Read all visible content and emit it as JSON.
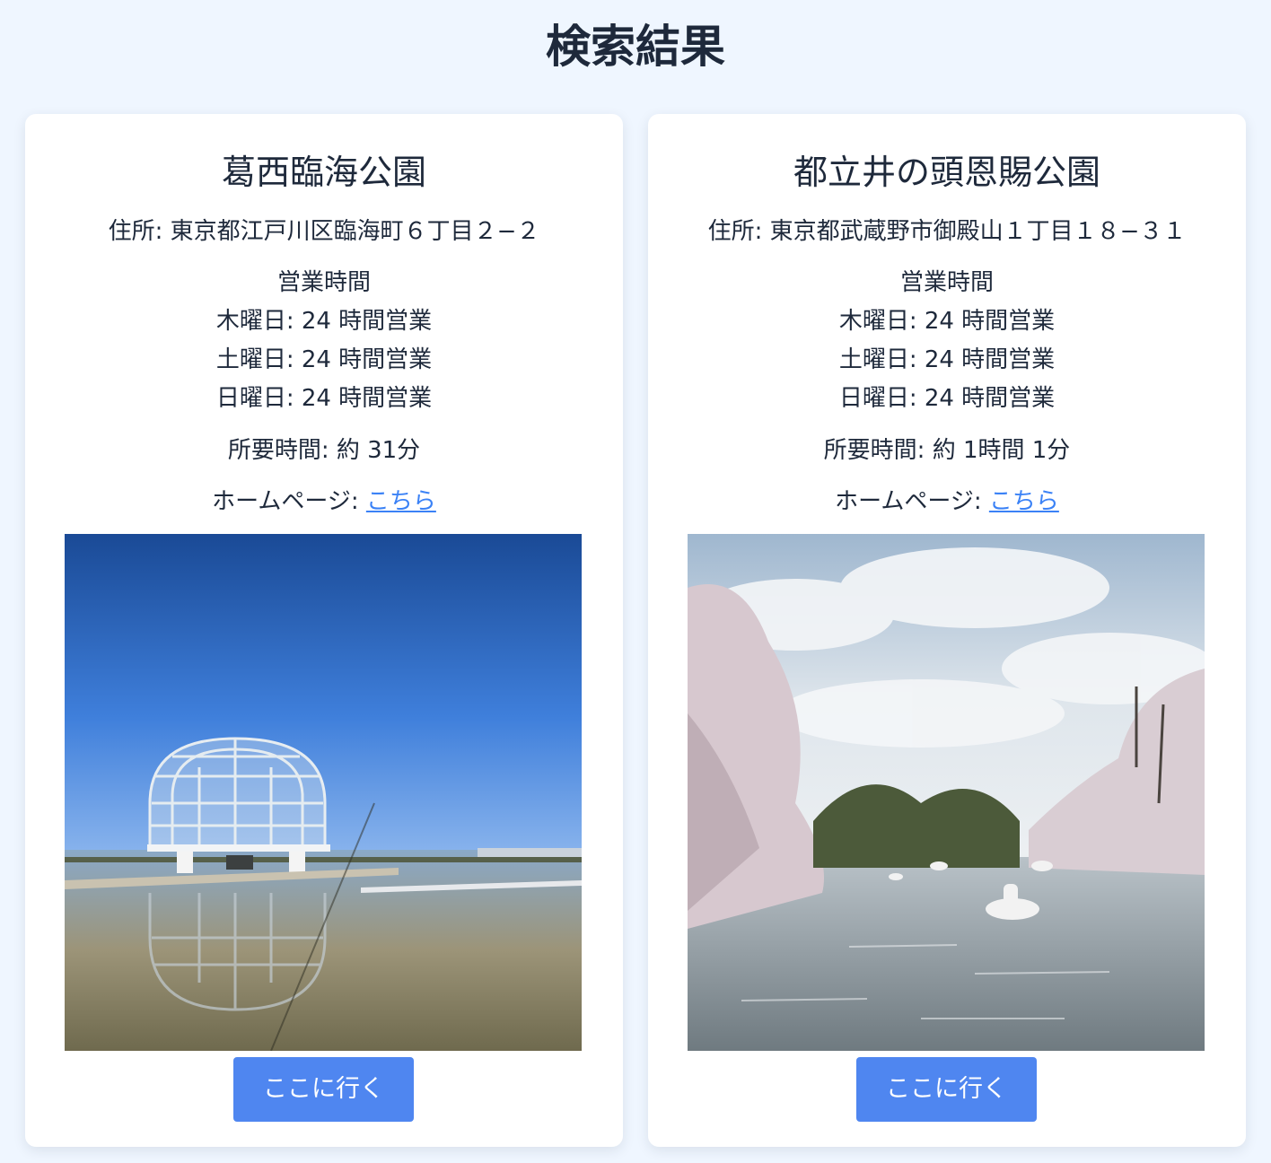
{
  "page": {
    "title": "検索結果"
  },
  "results": [
    {
      "name": "葛西臨海公園",
      "address": "住所: 東京都江戸川区臨海町６丁目２−２",
      "hours_heading": "営業時間",
      "hours": [
        "木曜日: 24 時間営業",
        "土曜日: 24 時間営業",
        "日曜日: 24 時間営業"
      ],
      "travel_time": "所要時間: 約 31分",
      "homepage_label": "ホームページ: ",
      "homepage_link": "こちら",
      "button_label": "ここに行く"
    },
    {
      "name": "都立井の頭恩賜公園",
      "address": "住所: 東京都武蔵野市御殿山１丁目１８−３１",
      "hours_heading": "営業時間",
      "hours": [
        "木曜日: 24 時間営業",
        "土曜日: 24 時間営業",
        "日曜日: 24 時間営業"
      ],
      "travel_time": "所要時間: 約 1時間 1分",
      "homepage_label": "ホームページ: ",
      "homepage_link": "こちら",
      "button_label": "ここに行く"
    }
  ],
  "colors": {
    "background": "#eff6ff",
    "card": "#ffffff",
    "text": "#1e293b",
    "link": "#3b82f6",
    "button": "#4f86f0"
  }
}
